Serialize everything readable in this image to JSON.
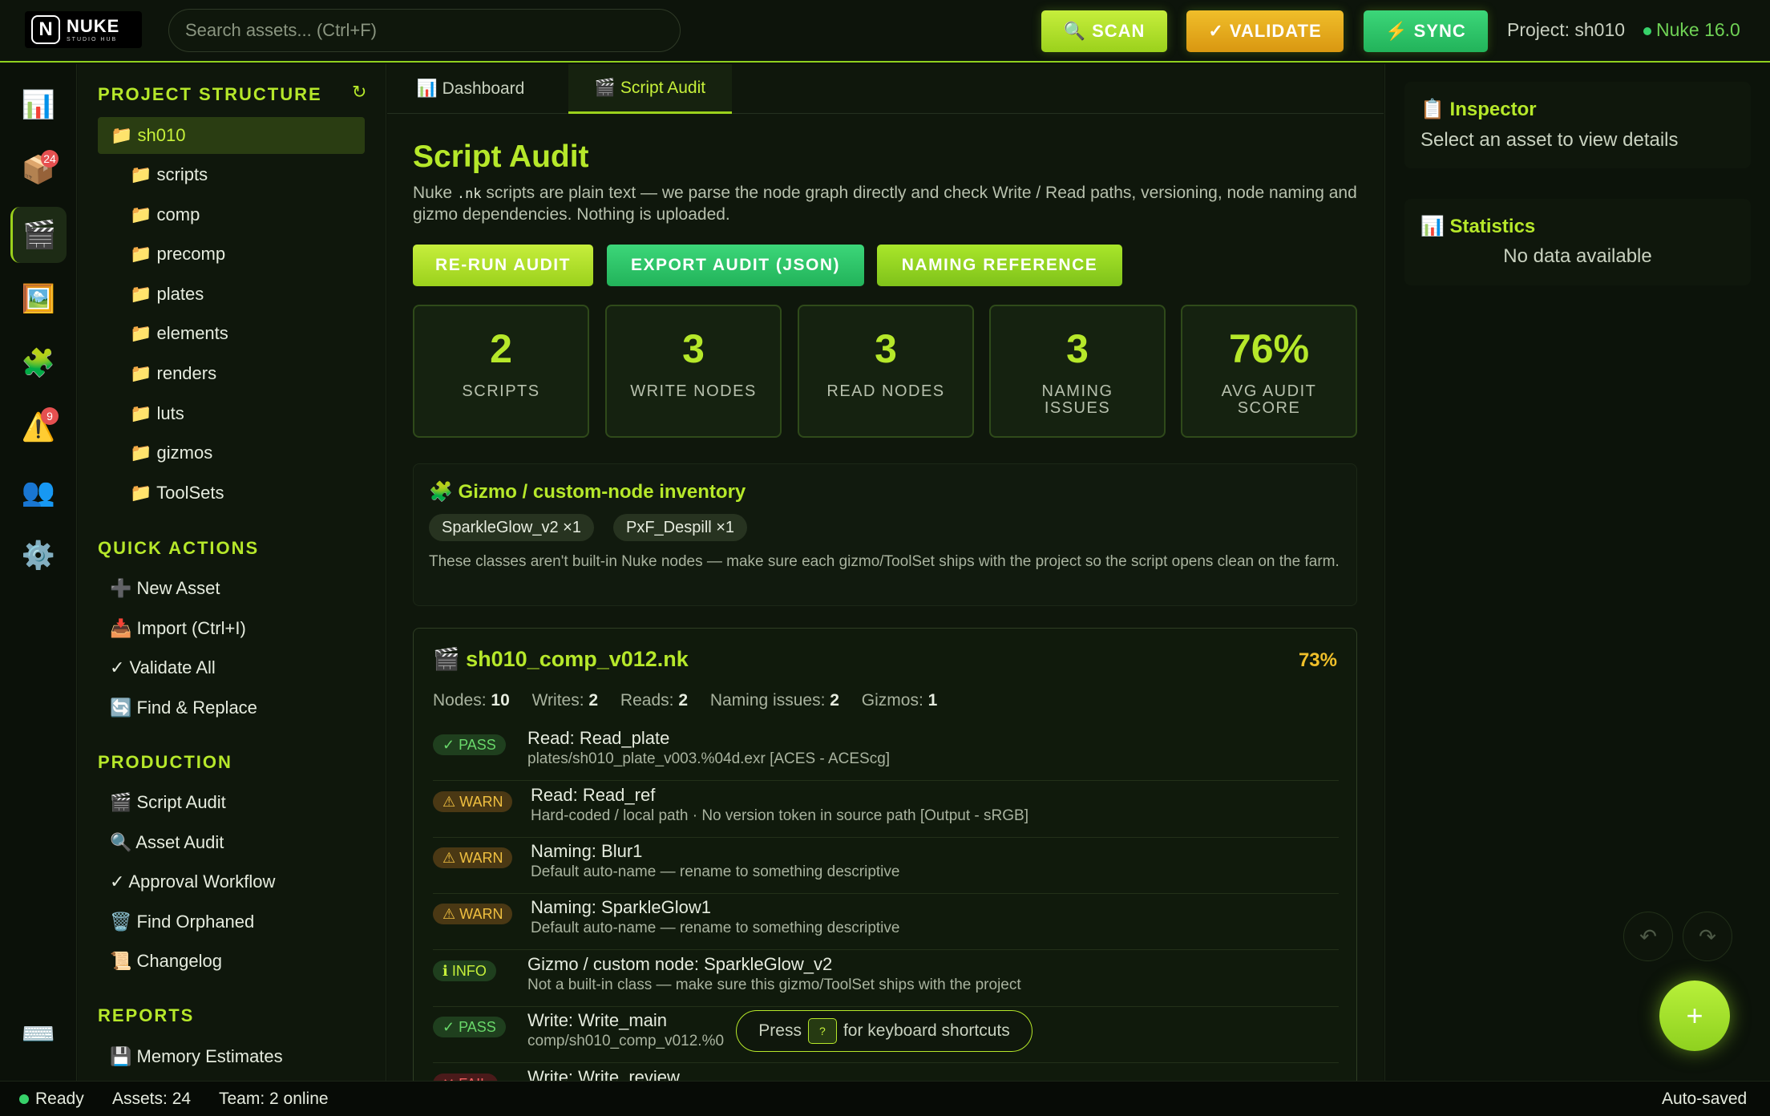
{
  "app": {
    "logo_letter": "N",
    "logo_name": "NUKE",
    "logo_sub": "STUDIO HUB"
  },
  "search": {
    "placeholder": "Search assets... (Ctrl+F)"
  },
  "top_actions": {
    "scan": "🔍 SCAN",
    "validate": "✓ VALIDATE",
    "sync": "⚡ SYNC"
  },
  "project_label": "Project: sh010",
  "version_label": "Nuke 16.0",
  "rail": [
    {
      "icon": "📊",
      "name": "dashboard-icon",
      "badge": ""
    },
    {
      "icon": "📦",
      "name": "assets-icon",
      "badge": "24"
    },
    {
      "icon": "🎬",
      "name": "script-audit-icon",
      "badge": ""
    },
    {
      "icon": "🖼️",
      "name": "image-icon",
      "badge": ""
    },
    {
      "icon": "🧩",
      "name": "gizmo-icon",
      "badge": ""
    },
    {
      "icon": "⚠️",
      "name": "warning-icon",
      "badge": "9"
    },
    {
      "icon": "👥",
      "name": "team-icon",
      "badge": ""
    },
    {
      "icon": "⚙️",
      "name": "settings-icon",
      "badge": ""
    },
    {
      "icon": "⌨️",
      "name": "keyboard-icon",
      "badge": ""
    }
  ],
  "sidebar": {
    "project_structure_title": "PROJECT STRUCTURE",
    "refresh_icon": "↻",
    "tree": [
      {
        "label": "📁 sh010"
      },
      {
        "label": "📁 scripts"
      },
      {
        "label": "📁 comp"
      },
      {
        "label": "📁 precomp"
      },
      {
        "label": "📁 plates"
      },
      {
        "label": "📁 elements"
      },
      {
        "label": "📁 renders"
      },
      {
        "label": "📁 luts"
      },
      {
        "label": "📁 gizmos"
      },
      {
        "label": "📁 ToolSets"
      }
    ],
    "quick_actions_title": "QUICK ACTIONS",
    "quick_actions": [
      {
        "label": "➕ New Asset"
      },
      {
        "label": "📥 Import (Ctrl+I)"
      },
      {
        "label": "✓ Validate All"
      },
      {
        "label": "🔄 Find & Replace"
      }
    ],
    "production_title": "PRODUCTION",
    "production": [
      {
        "label": "🎬 Script Audit"
      },
      {
        "label": "🔍 Asset Audit"
      },
      {
        "label": "✓ Approval Workflow"
      },
      {
        "label": "🗑️ Find Orphaned"
      },
      {
        "label": "📜 Changelog"
      }
    ],
    "reports_title": "REPORTS",
    "reports": [
      {
        "label": "💾 Memory Estimates"
      }
    ]
  },
  "tabs": [
    {
      "label": "📊 Dashboard"
    },
    {
      "label": "🎬 Script Audit"
    }
  ],
  "main": {
    "title": "Script Audit",
    "desc_prefix": "Nuke ",
    "desc_code": ".nk",
    "desc_suffix": " scripts are plain text — we parse the node graph directly and check Write / Read paths, versioning, node naming and gizmo dependencies. Nothing is uploaded.",
    "buttons": {
      "rerun": "RE-RUN AUDIT",
      "export": "EXPORT AUDIT (JSON)",
      "naming": "NAMING REFERENCE"
    },
    "stats": [
      {
        "value": "2",
        "label": "SCRIPTS"
      },
      {
        "value": "3",
        "label": "WRITE NODES"
      },
      {
        "value": "3",
        "label": "READ NODES"
      },
      {
        "value": "3",
        "label": "NAMING ISSUES"
      },
      {
        "value": "76%",
        "label": "AVG AUDIT SCORE"
      }
    ],
    "gizmo": {
      "title": "🧩 Gizmo / custom-node inventory",
      "chips": [
        "SparkleGlow_v2 ×1",
        "PxF_Despill ×1"
      ],
      "note": "These classes aren't built-in Nuke nodes — make sure each gizmo/ToolSet ships with the project so the script opens clean on the farm."
    },
    "script": {
      "title": "🎬 sh010_comp_v012.nk",
      "score": "73%",
      "meta": [
        {
          "k": "Nodes:",
          "v": "10"
        },
        {
          "k": "Writes:",
          "v": "2"
        },
        {
          "k": "Reads:",
          "v": "2"
        },
        {
          "k": "Naming issues:",
          "v": "2"
        },
        {
          "k": "Gizmos:",
          "v": "1"
        }
      ],
      "rows": [
        {
          "status": "pass",
          "pill": "✓ PASS",
          "title": "Read: Read_plate",
          "sub": "plates/sh010_plate_v003.%04d.exr [ACES - ACEScg]"
        },
        {
          "status": "warn",
          "pill": "⚠ WARN",
          "title": "Read: Read_ref",
          "sub": "Hard-coded / local path · No version token in source path [Output - sRGB]"
        },
        {
          "status": "warn",
          "pill": "⚠ WARN",
          "title": "Naming: Blur1",
          "sub": "Default auto-name — rename to something descriptive"
        },
        {
          "status": "warn",
          "pill": "⚠ WARN",
          "title": "Naming: SparkleGlow1",
          "sub": "Default auto-name — rename to something descriptive"
        },
        {
          "status": "info",
          "pill": "ℹ INFO",
          "title": "Gizmo / custom node: SparkleGlow_v2",
          "sub": "Not a built-in class — make sure this gizmo/ToolSet ships with the project"
        },
        {
          "status": "pass",
          "pill": "✓ PASS",
          "title": "Write: Write_main",
          "sub": "comp/sh010_comp_v012.%0"
        },
        {
          "status": "fail",
          "pill": "✕ FAIL",
          "title": "Write: Write_review",
          "sub": ""
        }
      ]
    }
  },
  "kbd_hint": {
    "prefix": "Press",
    "key": "?",
    "suffix": "for keyboard shortcuts"
  },
  "inspector": {
    "title": "📋 Inspector",
    "body": "Select an asset to view details"
  },
  "statistics": {
    "title": "📊 Statistics",
    "body": "No data available"
  },
  "undo_icon": "↶",
  "redo_icon": "↷",
  "fab_icon": "+",
  "status": {
    "ready": "Ready",
    "assets": "Assets: 24",
    "team": "Team: 2 online",
    "saved": "Auto-saved"
  },
  "colors": {
    "accent": "#b6e82a",
    "pass": "#69d86a",
    "warn": "#f0c040",
    "fail": "#f06060"
  }
}
